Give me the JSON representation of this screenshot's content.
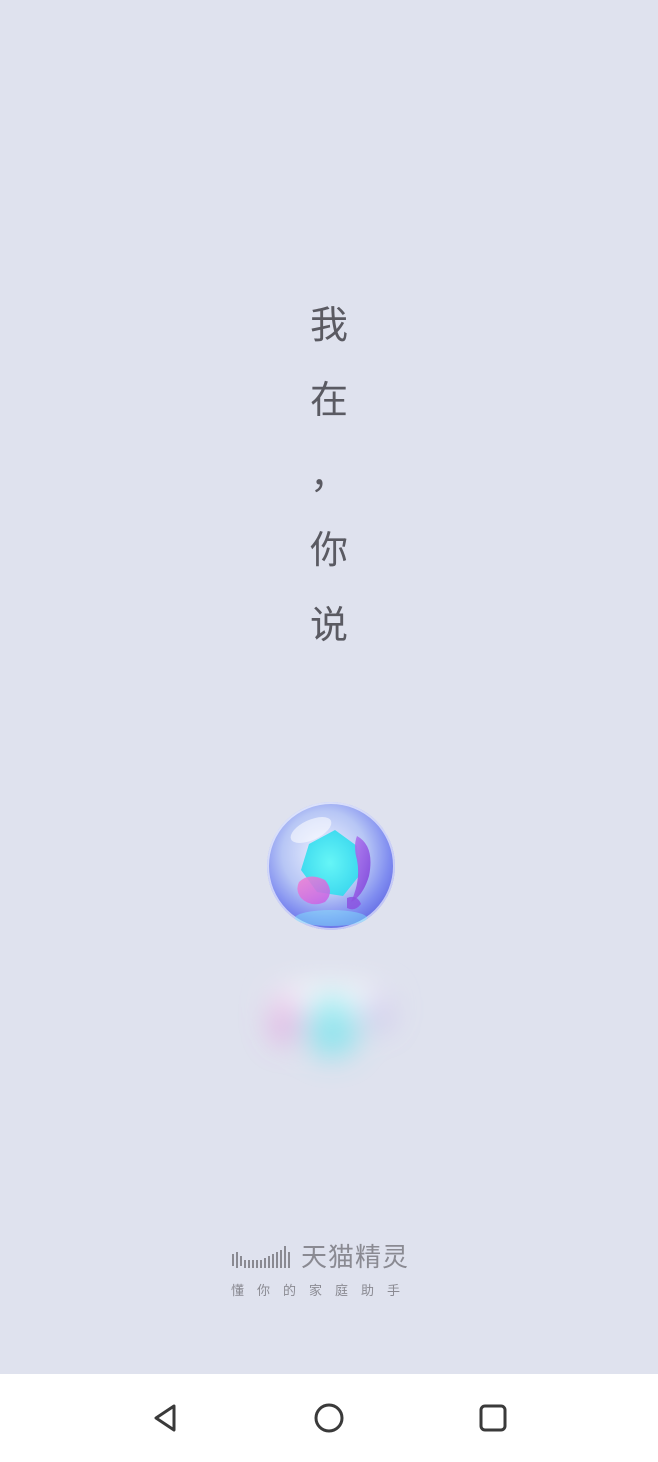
{
  "greeting": {
    "lines": [
      "我",
      "在",
      "，",
      "你",
      "说"
    ]
  },
  "orb": {
    "icon": "voice-assistant-orb-icon",
    "colors": {
      "cyan": "#3fe9f0",
      "purple": "#9b57e6",
      "pink": "#e76ac8",
      "blue": "#6b7df0"
    }
  },
  "brand": {
    "logo_icon": "tmall-genie-sound-bars-icon",
    "name": "天猫精灵",
    "tagline": "懂你的家庭助手",
    "color": "#8a8a92"
  },
  "nav_bar": {
    "back_icon": "back-triangle-icon",
    "home_icon": "home-circle-icon",
    "recents_icon": "recents-square-icon"
  },
  "colors": {
    "background": "#dfe2ee",
    "text": "#5a5a62",
    "nav_background": "#ffffff"
  }
}
